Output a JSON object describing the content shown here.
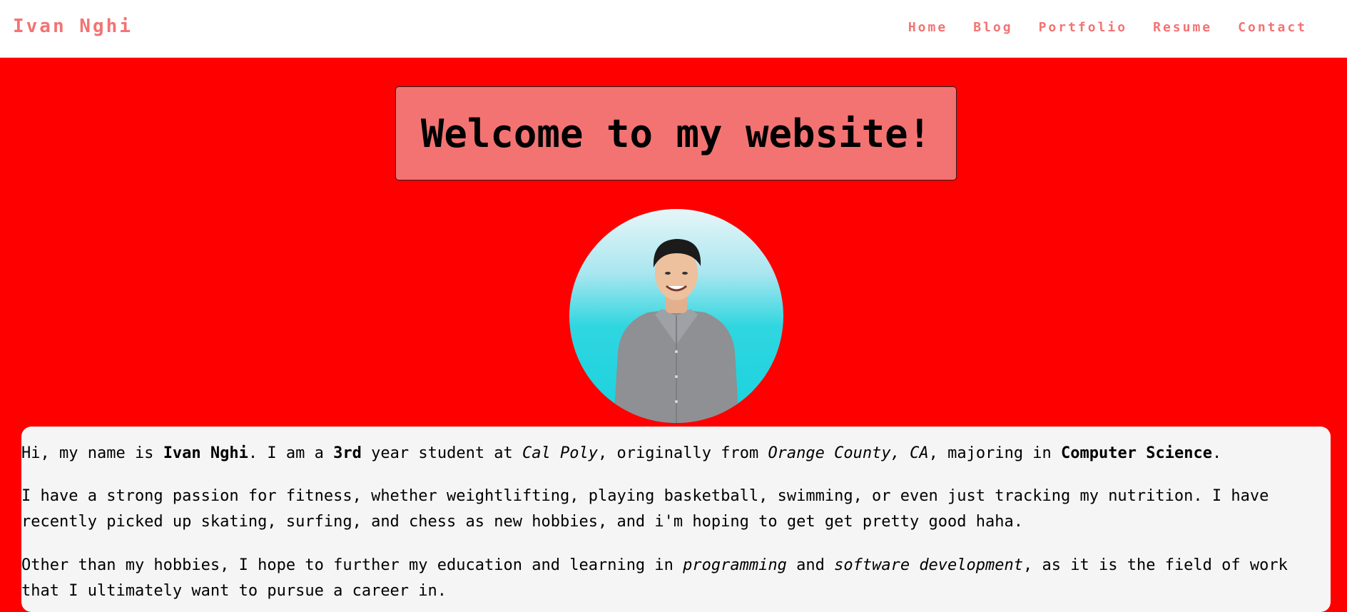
{
  "header": {
    "brand": "Ivan Nghi",
    "nav": [
      "Home",
      "Blog",
      "Portfolio",
      "Resume",
      "Contact"
    ]
  },
  "hero": {
    "title": "Welcome to my website!",
    "avatar_alt": "portrait-of-ivan"
  },
  "about": {
    "p1": {
      "a": "Hi, my name is ",
      "name": "Ivan Nghi",
      "b": ". I am a ",
      "year": "3rd",
      "c": " year student at ",
      "school": "Cal Poly",
      "d": ", originally from ",
      "hometown": "Orange County, CA",
      "e": ", majoring in ",
      "major": "Computer Science",
      "f": "."
    },
    "p2": "I have a strong passion for fitness, whether weightlifting, playing basketball, swimming, or even just tracking my nutrition. I have recently picked up skating, surfing, and chess as new hobbies, and i'm hoping to get get pretty good haha.",
    "p3": {
      "a": "Other than my hobbies, I hope to further my education and learning in ",
      "topic1": "programming",
      "b": " and ",
      "topic2": "software development",
      "c": ", as it is the field of work that I ultimately want to pursue a career in."
    }
  },
  "colors": {
    "page_bg": "#ff0000",
    "accent": "#f37373",
    "card_bg": "#f5f5f5"
  }
}
